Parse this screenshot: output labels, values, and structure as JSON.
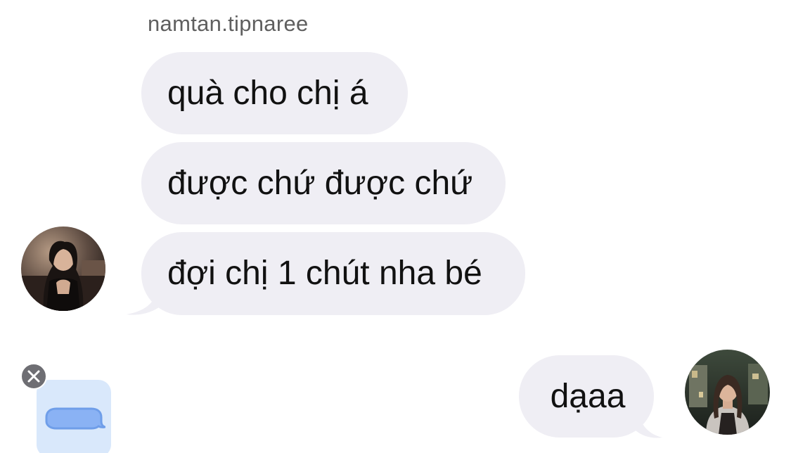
{
  "conversation": {
    "sender_name": "namtan.tipnaree",
    "messages": [
      {
        "direction": "incoming",
        "text": "quà cho chị á"
      },
      {
        "direction": "incoming",
        "text": "được chứ được chứ"
      },
      {
        "direction": "incoming",
        "text": "đợi chị 1 chút nha bé"
      },
      {
        "direction": "outgoing",
        "text": "dạaa"
      }
    ]
  },
  "avatars": {
    "incoming": {
      "icon": "profile-photo-avatar"
    },
    "outgoing": {
      "icon": "profile-photo-avatar"
    }
  },
  "compose_attachment": {
    "icon": "message-bubble-icon",
    "dismiss_icon": "close-icon"
  },
  "colors": {
    "incoming_bubble": "#efeef4",
    "outgoing_bubble": "#efeef4",
    "sender_name": "#5f5f5f",
    "attachment_card": "#d9e8fb",
    "attachment_icon": "#8ab2f4",
    "close_badge": "#6e6e73"
  }
}
